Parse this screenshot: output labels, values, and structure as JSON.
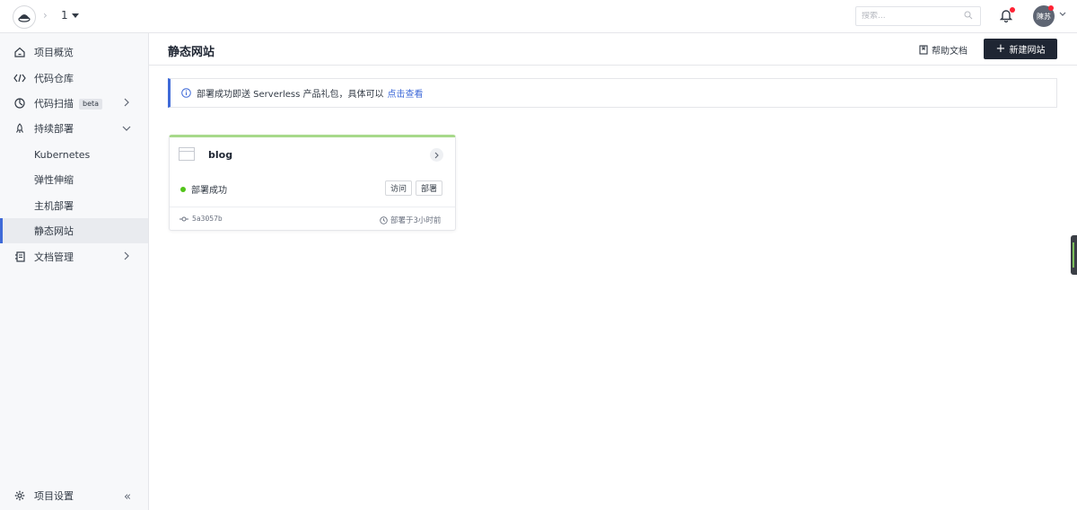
{
  "topbar": {
    "project": "1",
    "search_placeholder": "搜索...",
    "user_initials": "陳苏"
  },
  "sidebar": {
    "items": [
      {
        "label": "项目概览",
        "icon": "home-icon"
      },
      {
        "label": "代码仓库",
        "icon": "code-icon"
      },
      {
        "label": "代码扫描",
        "icon": "scan-icon",
        "badge": "beta"
      },
      {
        "label": "持续部署",
        "icon": "rocket-icon"
      },
      {
        "label": "Kubernetes"
      },
      {
        "label": "弹性伸缩"
      },
      {
        "label": "主机部署"
      },
      {
        "label": "静态网站",
        "active": true
      },
      {
        "label": "文档管理",
        "icon": "document-icon"
      }
    ],
    "settings_label": "项目设置"
  },
  "main": {
    "title": "静态网站",
    "help_label": "帮助文档",
    "new_button_label": "新建网站",
    "notice": {
      "text": "部署成功即送 Serverless 产品礼包，具体可以",
      "link": "点击查看"
    },
    "card": {
      "name": "blog",
      "status": "部署成功",
      "visit_label": "访问",
      "deploy_label": "部署",
      "commit": "5a3057b",
      "time": "部署于3小时前"
    }
  },
  "colors": {
    "accent": "#3f6ad8",
    "success": "#52c41a",
    "card_top": "#a7d98a",
    "dark_button": "#1f2633"
  }
}
